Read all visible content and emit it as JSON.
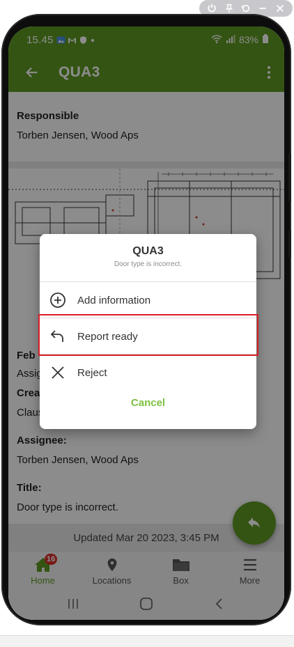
{
  "status": {
    "time": "15.45",
    "battery": "83%"
  },
  "appbar": {
    "title": "QUA3"
  },
  "content": {
    "responsible_label": "Responsible",
    "responsible_value": "Torben Jensen, Wood Aps",
    "partial_label_1": "Feb",
    "partial_value_1": "Assig",
    "partial_label_2": "Crea",
    "partial_value_2": "Claus",
    "assignee_label": "Assignee:",
    "assignee_value": "Torben Jensen, Wood Aps",
    "title_label": "Title:",
    "title_value": "Door type is incorrect.",
    "updated": "Updated Mar 20 2023, 3:45 PM"
  },
  "dialog": {
    "title": "QUA3",
    "subtitle": "Door type is incorrect.",
    "items": [
      {
        "label": "Add information",
        "icon": "plus-circle-icon"
      },
      {
        "label": "Report ready",
        "icon": "return-arrow-icon"
      },
      {
        "label": "Reject",
        "icon": "close-icon"
      }
    ],
    "cancel": "Cancel"
  },
  "bottomnav": {
    "items": [
      {
        "label": "Home",
        "icon": "home-icon"
      },
      {
        "label": "Locations",
        "icon": "location-pin-icon"
      },
      {
        "label": "Box",
        "icon": "folder-icon"
      },
      {
        "label": "More",
        "icon": "menu-icon"
      }
    ],
    "badge": "16"
  },
  "colors": {
    "brand_green": "#5f9a23",
    "cancel_green": "#7dc242",
    "badge_red": "#d9302c",
    "highlight_red": "#d81f26"
  }
}
